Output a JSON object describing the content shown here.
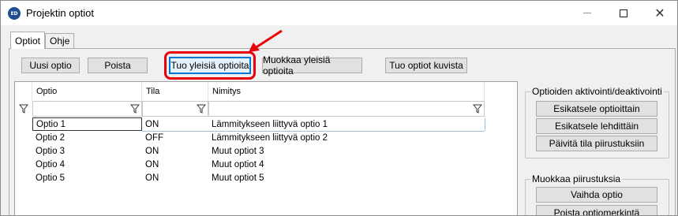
{
  "window": {
    "title": "Projektin optiot",
    "app_icon_text": "ED",
    "controls": {
      "minimize": "—",
      "maximize": "☐",
      "close": "✕"
    }
  },
  "tabs": [
    {
      "label": "Optiot",
      "active": true
    },
    {
      "label": "Ohje",
      "active": false
    }
  ],
  "toolbar": {
    "new_option": "Uusi optio",
    "delete": "Poista",
    "import_general": "Tuo yleisiä optioita",
    "edit_general": "Muokkaa yleisiä optioita",
    "import_from_images": "Tuo optiot kuvista"
  },
  "grid": {
    "columns": [
      "Optio",
      "Tila",
      "Nimitys"
    ],
    "rows": [
      {
        "optio": "Optio 1",
        "tila": "ON",
        "nimitys": "Lämmitykseen liittyvä optio 1"
      },
      {
        "optio": "Optio 2",
        "tila": "OFF",
        "nimitys": "Lämmitykseen liittyvä optio 2"
      },
      {
        "optio": "Optio 3",
        "tila": "ON",
        "nimitys": "Muut optiot 3"
      },
      {
        "optio": "Optio 4",
        "tila": "ON",
        "nimitys": "Muut optiot 4"
      },
      {
        "optio": "Optio 5",
        "tila": "ON",
        "nimitys": "Muut optiot 5"
      }
    ]
  },
  "activation_group": {
    "title": "Optioiden aktivointi/deaktivointi",
    "preview_by_option": "Esikatsele optioittain",
    "preview_by_sheet": "Esikatsele lehdittäin",
    "update_drawings": "Päivitä tila piirustuksiin"
  },
  "edit_drawings_group": {
    "title": "Muokkaa piirustuksia",
    "change_option": "Vaihda optio",
    "remove_marking": "Poista optiomerkintä"
  },
  "colors": {
    "highlight_red": "#e8000b",
    "focus_blue": "#0078d7"
  }
}
